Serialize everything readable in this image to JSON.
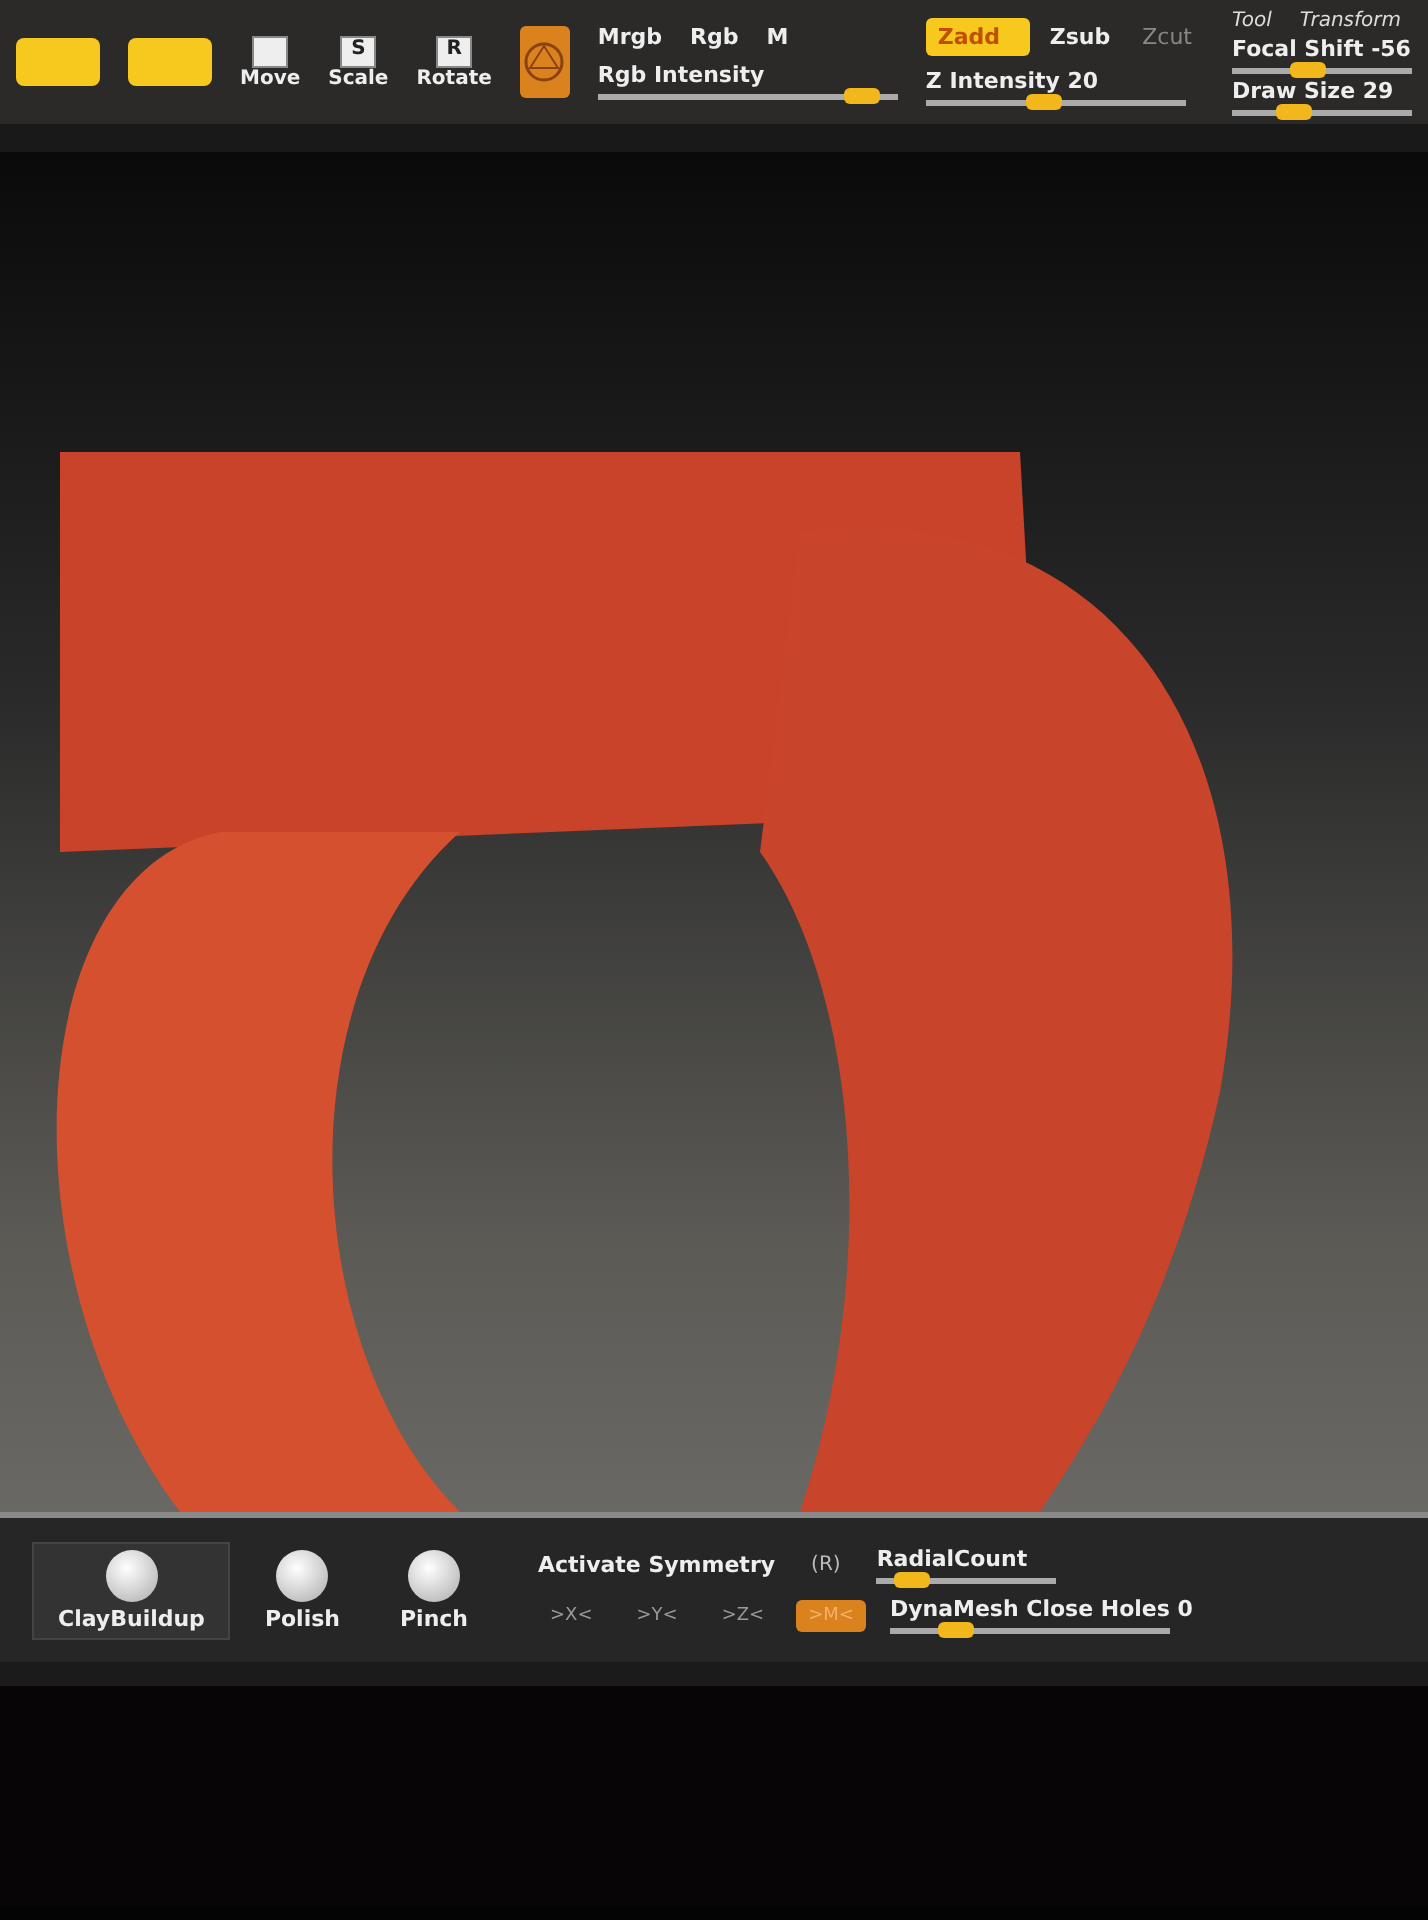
{
  "top_toolbar": {
    "mode_buttons": [
      {
        "selected": true
      },
      {
        "selected": true
      }
    ],
    "transform_buttons": [
      {
        "label": "Move"
      },
      {
        "label": "Scale",
        "key": "S"
      },
      {
        "label": "Rotate",
        "key": "R"
      }
    ],
    "color_modes": [
      {
        "label": "Mrgb"
      },
      {
        "label": "Rgb"
      },
      {
        "label": "M"
      }
    ],
    "rgb_intensity": {
      "label": "Rgb Intensity",
      "level": 0.93
    },
    "z_modes": [
      {
        "label": "Zadd",
        "selected": true,
        "disabled": false
      },
      {
        "label": "Zsub",
        "selected": false,
        "disabled": false
      },
      {
        "label": "Zcut",
        "selected": false,
        "disabled": true
      }
    ],
    "z_intensity": {
      "label": "Z Intensity 20",
      "level": 0.45
    },
    "menus": [
      "Tool",
      "Transform"
    ],
    "focal_shift": {
      "label": "Focal Shift -56",
      "level": 0.4
    },
    "draw_size": {
      "label": "Draw Size 29",
      "level": 0.3
    }
  },
  "bottom_toolbar": {
    "brushes": [
      {
        "label": "ClayBuildup",
        "selected": true
      },
      {
        "label": "Polish",
        "selected": false
      },
      {
        "label": "Pinch",
        "selected": false
      }
    ],
    "symmetry": {
      "label": "Activate Symmetry",
      "radial_button": "(R)",
      "radial_count": {
        "label": "RadialCount",
        "level": 0.12
      },
      "axes": [
        {
          "label": ">X<",
          "selected": false
        },
        {
          "label": ">Y<",
          "selected": false
        },
        {
          "label": ">Z<",
          "selected": false
        },
        {
          "label": ">M<",
          "selected": true
        }
      ]
    },
    "close_holes": {
      "label": "DynaMesh Close Holes 0",
      "level": 0.2
    }
  }
}
